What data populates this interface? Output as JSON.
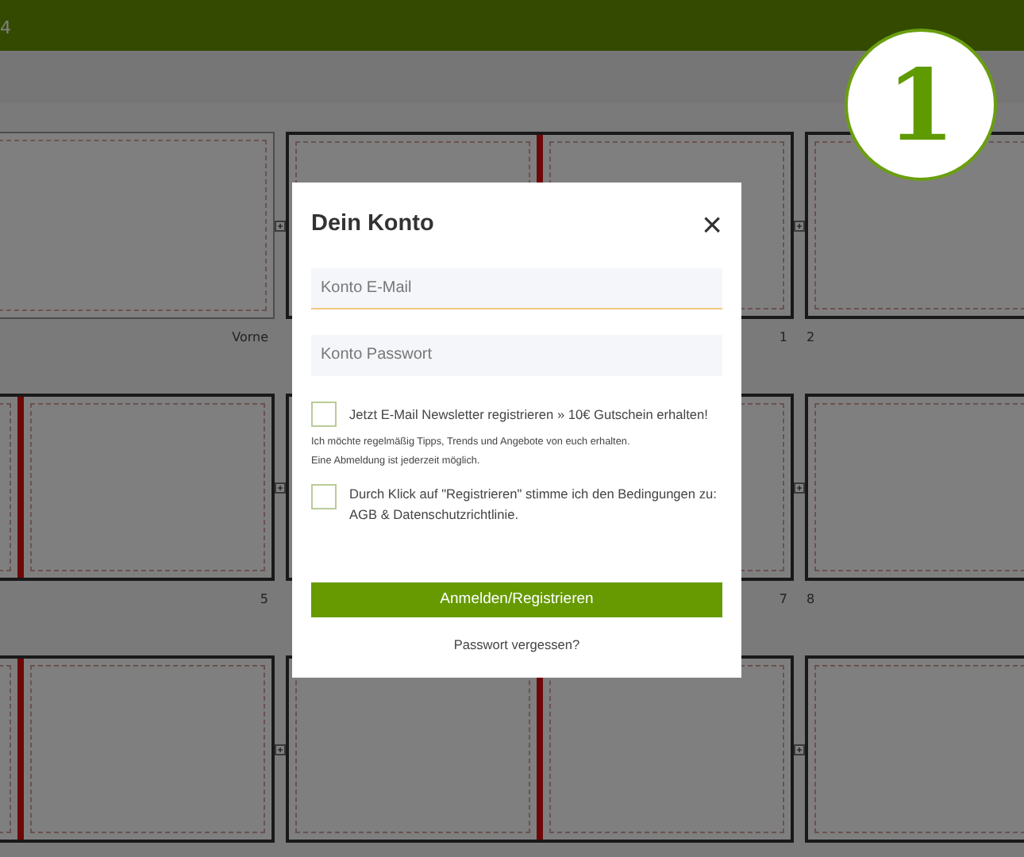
{
  "header": {
    "text": "4"
  },
  "step_badge": {
    "text": "1"
  },
  "spread_rows": [
    {
      "spreads": [
        {
          "kind": "cover",
          "right_label": "Vorne"
        },
        {
          "kind": "double",
          "right_label": "1"
        },
        {
          "kind": "double",
          "left_label": "2"
        }
      ]
    },
    {
      "spreads": [
        {
          "kind": "double",
          "right_label": "5"
        },
        {
          "kind": "double",
          "right_label": "7"
        },
        {
          "kind": "double",
          "left_label": "8"
        }
      ]
    },
    {
      "spreads": [
        {
          "kind": "double"
        },
        {
          "kind": "double"
        },
        {
          "kind": "double"
        }
      ]
    }
  ],
  "dialog": {
    "title": "Dein Konto",
    "close": "×",
    "fields": [
      {
        "placeholder": "Konto E-Mail",
        "focused": true
      },
      {
        "placeholder": "Konto Passwort",
        "focused": false
      }
    ],
    "newsletter": {
      "checked": false,
      "label": "Jetzt E-Mail Newsletter registrieren » 10€ Gutschein erhalten!",
      "note": "Ich möchte regelmäßig Tipps, Trends und Angebote von euch erhalten.",
      "note_2": "Eine Abmeldung ist jederzeit möglich."
    },
    "terms": {
      "checked": false,
      "label": "Durch Klick auf \"Registrieren\" stimme ich den Bedingungen zu: AGB & Datenschutzrichtlinie."
    },
    "submit": "Anmelden/Registrieren",
    "forgot": "Passwort vergessen?"
  }
}
